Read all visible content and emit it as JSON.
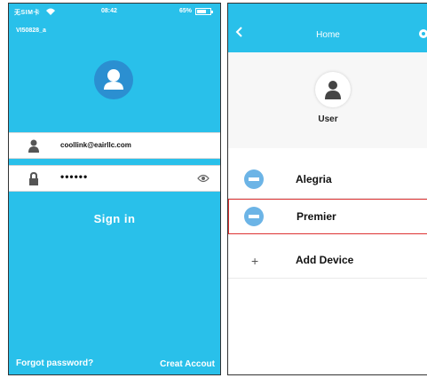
{
  "login_screen": {
    "status_bar": {
      "carrier": "无SIM卡",
      "time": "08:42",
      "battery": "65%",
      "wifi_icon": "wifi-icon",
      "battery_icon": "battery-icon"
    },
    "ssid": "VI50828_a",
    "avatar_icon": "user-avatar-icon",
    "username_field": {
      "value": "coollink@eairllc.com",
      "icon": "user-icon"
    },
    "password_field": {
      "value": "••••••",
      "icon": "lock-icon",
      "toggle_icon": "eye-icon"
    },
    "sign_in_label": "Sign in",
    "forgot_password_label": "Forgot password?",
    "create_account_label": "Creat Accout",
    "colors": {
      "background": "#29c0ea",
      "avatar": "#2b8fd1"
    }
  },
  "home_screen": {
    "header": {
      "title": "Home",
      "back_icon": "chevron-left-icon",
      "settings_icon": "gear-icon"
    },
    "user_label": "User",
    "devices": [
      {
        "name": "Alegria",
        "icon": "air-conditioner-icon",
        "selected": false
      },
      {
        "name": "Premier",
        "icon": "air-conditioner-icon",
        "selected": true
      }
    ],
    "add_device_label": "Add Device",
    "add_icon": "plus-icon",
    "colors": {
      "header": "#29c0ea",
      "device_icon": "#6cb4e6",
      "highlight_border": "#dd3333"
    }
  }
}
